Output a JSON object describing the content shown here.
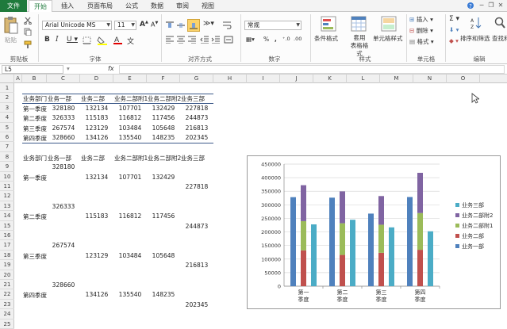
{
  "tabs": [
    "文件",
    "开始",
    "插入",
    "页面布局",
    "公式",
    "数据",
    "审阅",
    "视图"
  ],
  "active_tab": "开始",
  "ribbon": {
    "clipboard": {
      "paste": "粘贴",
      "label": "剪贴板"
    },
    "font": {
      "name": "Arial Unicode MS",
      "size": "11",
      "label": "字体"
    },
    "alignment": {
      "label": "对齐方式"
    },
    "number": {
      "format": "常规",
      "label": "数字"
    },
    "styles": {
      "conditional": "条件格式",
      "table_format": "套用\n表格格式",
      "cell_styles": "单元格样式",
      "label": "样式"
    },
    "cells": {
      "insert": "插入",
      "delete": "删除",
      "format": "格式",
      "label": "单元格"
    },
    "editing": {
      "sort": "排序和筛选",
      "find": "查找和",
      "label": "编辑"
    }
  },
  "formula_bar": {
    "name_box": "L5",
    "fx": "fx",
    "value": ""
  },
  "columns": [
    "A",
    "B",
    "C",
    "D",
    "E",
    "F",
    "G",
    "H",
    "I",
    "J",
    "K",
    "L",
    "M",
    "N",
    "O"
  ],
  "rows": [
    "1",
    "2",
    "3",
    "4",
    "5",
    "6",
    "7",
    "8",
    "9",
    "10",
    "11",
    "12",
    "13",
    "14",
    "15",
    "16",
    "17",
    "18",
    "19",
    "20",
    "21",
    "22",
    "23",
    "24",
    "25"
  ],
  "table1": {
    "headers": [
      "业务部门",
      "业务一部",
      "业务二部",
      "业务二部附1",
      "业务二部附2",
      "业务三部"
    ],
    "rows": [
      [
        "第一季度",
        "328180",
        "132134",
        "107701",
        "132429",
        "227818"
      ],
      [
        "第二季度",
        "326333",
        "115183",
        "116812",
        "117456",
        "244873"
      ],
      [
        "第三季度",
        "267574",
        "123129",
        "103484",
        "105648",
        "216813"
      ],
      [
        "第四季度",
        "328660",
        "134126",
        "135540",
        "148235",
        "202345"
      ]
    ]
  },
  "table2": {
    "headers": [
      "业务部门",
      "业务一部",
      "业务二部",
      "业务二部附1",
      "业务二部附2",
      "业务三部"
    ],
    "rows": [
      [
        "第一季度",
        "328180",
        "132134",
        "107701",
        "132429",
        "227818"
      ],
      [
        "第二季度",
        "326333",
        "115183",
        "116812",
        "117456",
        "244873"
      ],
      [
        "第三季度",
        "267574",
        "123129",
        "103484",
        "105648",
        "216813"
      ],
      [
        "第四季度",
        "328660",
        "134126",
        "135540",
        "148235",
        "202345"
      ]
    ]
  },
  "chart_data": {
    "type": "bar",
    "categories": [
      "第一\n季度",
      "第二\n季度",
      "第三\n季度",
      "第四\n季度"
    ],
    "ylim": [
      0,
      450000
    ],
    "yticks": [
      "0",
      "50000",
      "100000",
      "150000",
      "200000",
      "250000",
      "300000",
      "350000",
      "400000",
      "450000"
    ],
    "series": [
      {
        "name": "业务一部",
        "values": [
          328180,
          326333,
          267574,
          328660
        ],
        "color": "#4f81bd",
        "stack": "a"
      },
      {
        "name": "业务二部",
        "values": [
          132134,
          115183,
          123129,
          134126
        ],
        "color": "#c0504d",
        "stack": "b"
      },
      {
        "name": "业务二部附1",
        "values": [
          107701,
          116812,
          103484,
          135540
        ],
        "color": "#9bbb59",
        "stack": "b"
      },
      {
        "name": "业务二部附2",
        "values": [
          132429,
          117456,
          105648,
          148235
        ],
        "color": "#8064a2",
        "stack": "b"
      },
      {
        "name": "业务三部",
        "values": [
          227818,
          244873,
          216813,
          202345
        ],
        "color": "#4bacc6",
        "stack": "c"
      }
    ],
    "legend": [
      "业务三部",
      "业务二部附2",
      "业务二部附1",
      "业务二部",
      "业务一部"
    ],
    "legend_position": "right",
    "grid": true
  }
}
